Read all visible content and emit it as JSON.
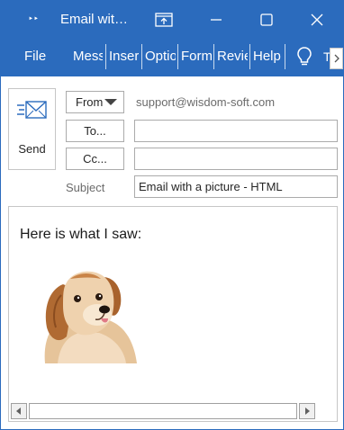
{
  "window": {
    "title": "Email wit…",
    "qat_glyph": "‣‣"
  },
  "ribbon": {
    "tabs": [
      "File",
      "Mess",
      "Inser",
      "Optio",
      "Form",
      "Revie",
      "Help"
    ],
    "tell_me": "T"
  },
  "header": {
    "send_label": "Send",
    "from_label": "From",
    "from_address": "support@wisdom-soft.com",
    "to_label": "To...",
    "cc_label": "Cc...",
    "to_value": "",
    "cc_value": "",
    "subject_label": "Subject",
    "subject_value": "Email with a picture - HTML"
  },
  "body": {
    "text": "Here is what I saw:",
    "image_icon": "puppy-photo"
  },
  "colors": {
    "titlebar": "#2b6bbd",
    "border": "#c6c6c6"
  }
}
